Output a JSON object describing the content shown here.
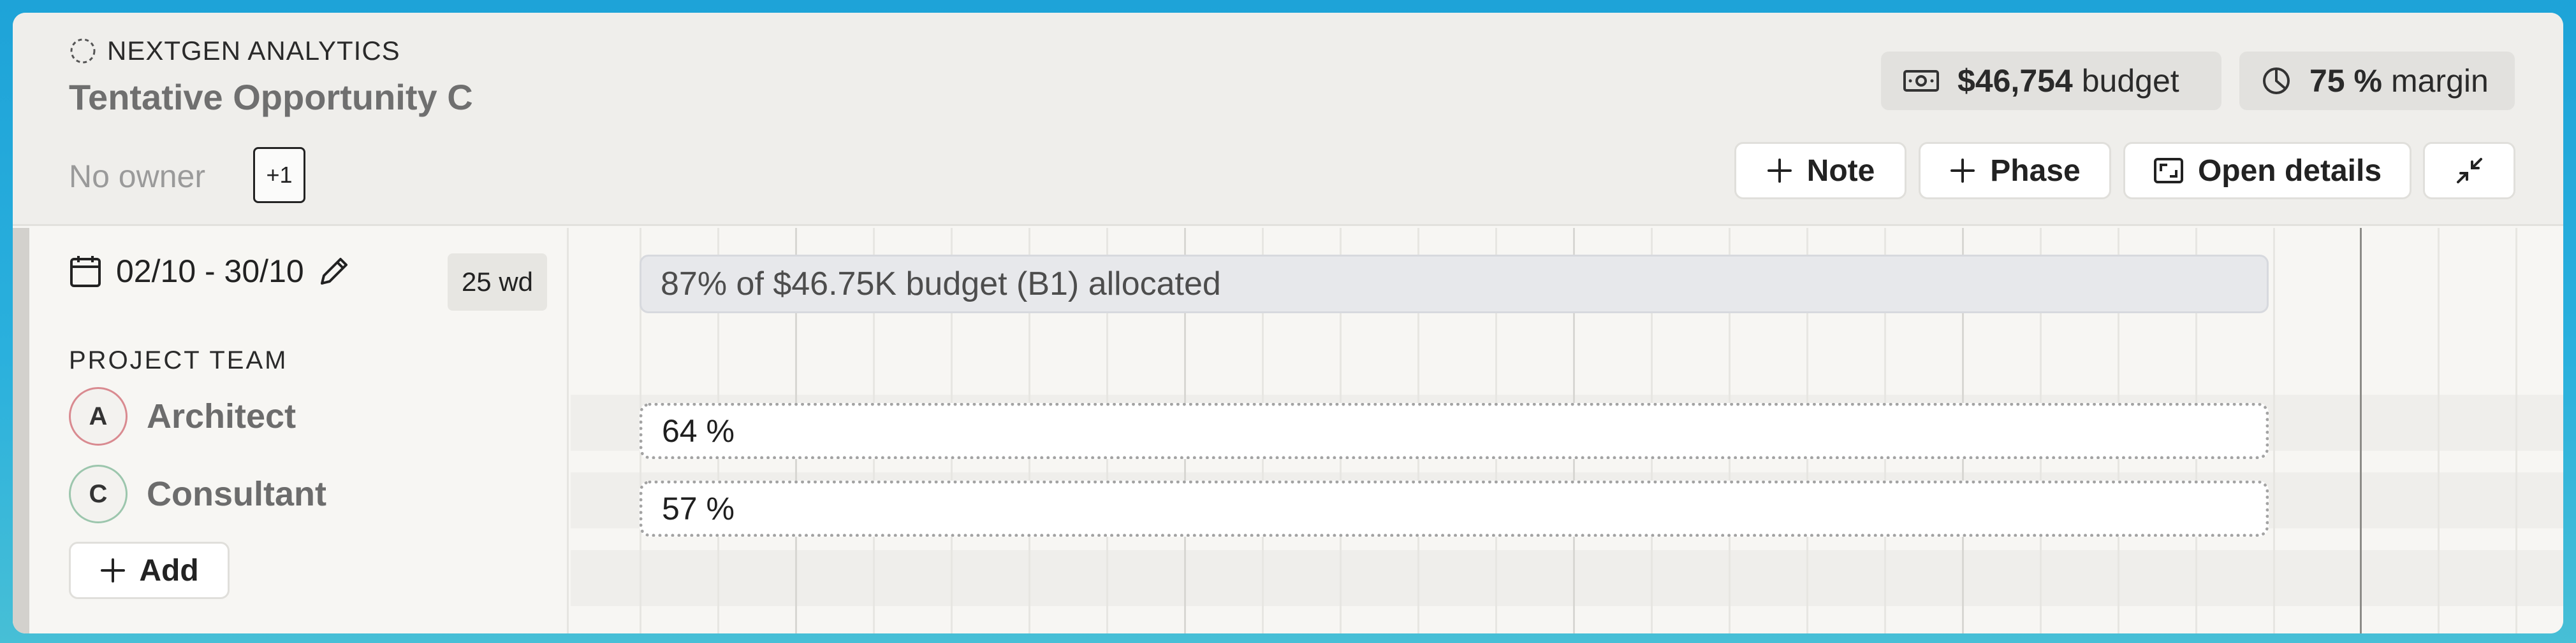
{
  "header": {
    "client_name": "NEXTGEN ANALYTICS",
    "title": "Tentative Opportunity C",
    "owner_text": "No owner",
    "extra_count": "+1",
    "budget_value": "$46,754",
    "budget_suffix": "budget",
    "margin_value": "75 %",
    "margin_suffix": "margin",
    "buttons": {
      "note": "Note",
      "phase": "Phase",
      "open_details": "Open details"
    }
  },
  "schedule": {
    "date_range": "02/10 - 30/10",
    "working_days": "25 wd"
  },
  "team": {
    "section_label": "PROJECT TEAM",
    "members": [
      {
        "initial": "A",
        "role": "Architect",
        "allocation": "64 %",
        "ring_color": "#d98a90"
      },
      {
        "initial": "C",
        "role": "Consultant",
        "allocation": "57 %",
        "ring_color": "#9cc6ad"
      }
    ],
    "add_label": "Add"
  },
  "timeline": {
    "summary_text": "87% of $46.75K budget (B1) allocated"
  },
  "colors": {
    "frame_background": "#f7f6f3",
    "header_background": "#efeeeb",
    "summary_bar": "#e7e8eb",
    "page_gradient_top": "#1ea3d8"
  },
  "icons": [
    "dashed-circle-icon",
    "banknote-icon",
    "pie-chart-icon",
    "plus-icon",
    "expand-icon",
    "collapse-icon",
    "calendar-icon",
    "pencil-icon"
  ]
}
